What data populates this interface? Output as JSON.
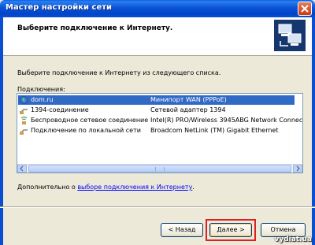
{
  "window": {
    "title": "Мастер настройки сети",
    "heading": "Выберите подключение к Интернету."
  },
  "content": {
    "instruction": "Выберите подключение к Интернету из следующего списка.",
    "list_label": "Подключения:",
    "connections": [
      {
        "name": "dom.ru",
        "adapter": "Минипорт WAN (PPPoE)",
        "icon": "globe-icon",
        "selected": true
      },
      {
        "name": "1394-соединение",
        "adapter": "Сетевой адаптер 1394",
        "icon": "network-connection-icon",
        "selected": false
      },
      {
        "name": "Беспроводное сетевое соединение",
        "adapter": "Intel(R) PRO/Wireless 3945ABG Network Connect",
        "icon": "wireless-icon",
        "selected": false
      },
      {
        "name": "Подключение по локальной сети",
        "adapter": "Broadcom NetLink (TM) Gigabit Ethernet",
        "icon": "network-connection-icon",
        "selected": false
      }
    ],
    "extra_prefix": "Дополнительно о ",
    "extra_link": "выборе подключения к Интернету",
    "extra_suffix": "."
  },
  "buttons": {
    "back": "< Назад",
    "next": "Далее >",
    "cancel": "Отмена"
  },
  "watermark": "vydiat.ua",
  "colors": {
    "titlebar": "#0b53d6",
    "selection": "#316ac5",
    "highlight_frame": "#e0201e",
    "link": "#0000ff"
  }
}
